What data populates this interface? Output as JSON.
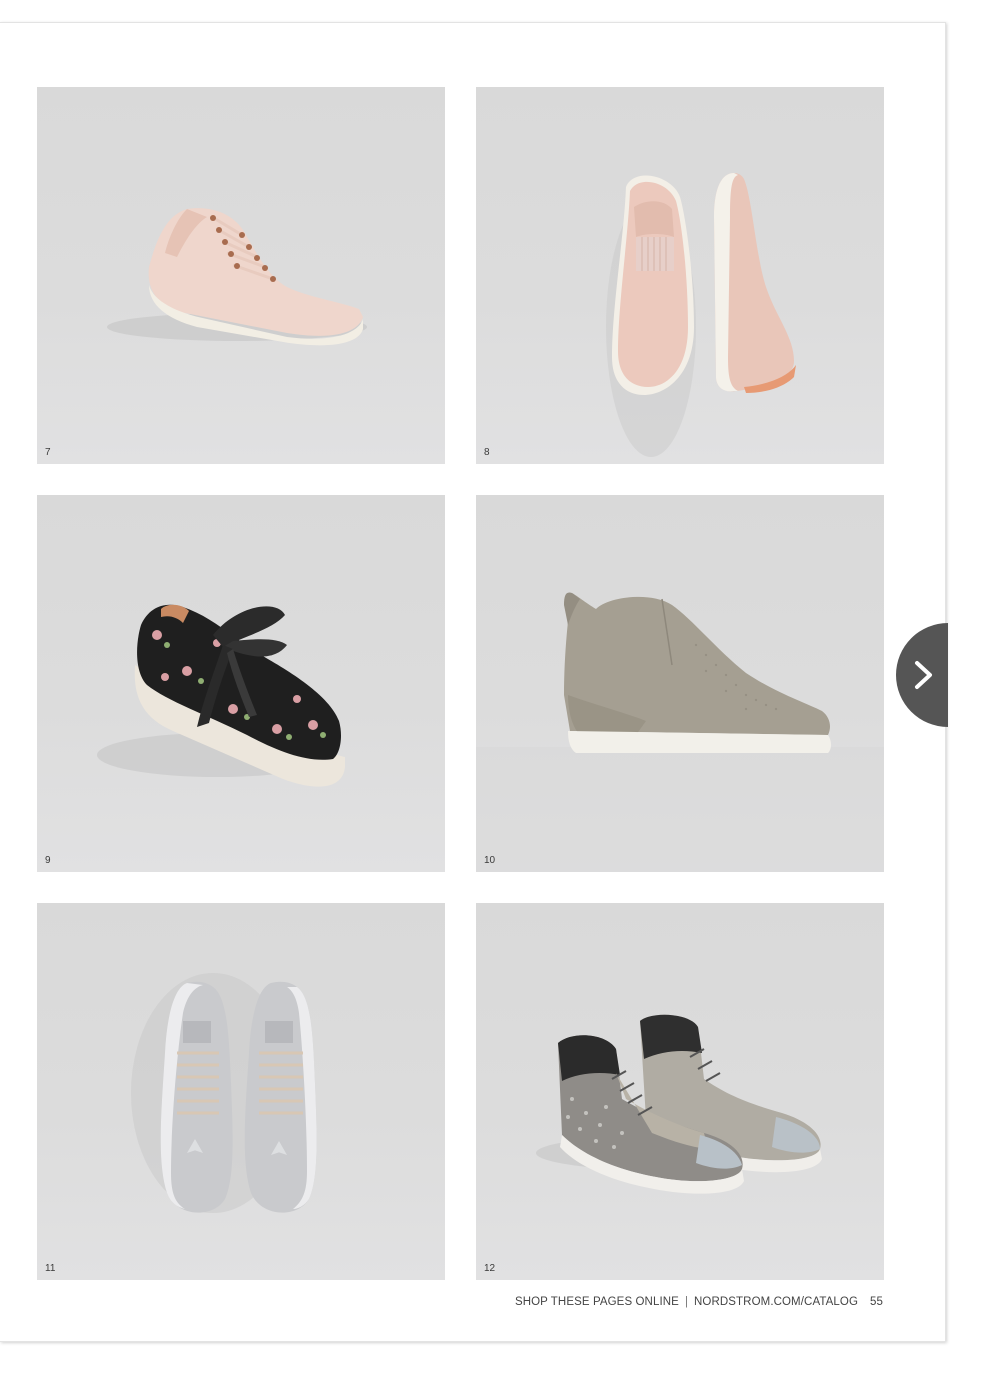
{
  "catalog": {
    "tiles": [
      {
        "number": "7",
        "product": "blush-low-top-sneaker"
      },
      {
        "number": "8",
        "product": "blush-scallop-slip-on-sneaker"
      },
      {
        "number": "9",
        "product": "floral-ribbon-lace-sneaker"
      },
      {
        "number": "10",
        "product": "taupe-wedge-sneaker"
      },
      {
        "number": "11",
        "product": "silver-metallic-sneaker"
      },
      {
        "number": "12",
        "product": "glitter-high-top-sneaker"
      }
    ],
    "footer": {
      "shop_text": "SHOP THESE PAGES ONLINE",
      "separator": "|",
      "site": "NORDSTROM.COM/CATALOG",
      "page_number": "55"
    }
  },
  "navigation": {
    "next_icon": "chevron-right-icon"
  },
  "colors": {
    "tile_background": "#dcdcdc",
    "nav_button": "#555555"
  }
}
